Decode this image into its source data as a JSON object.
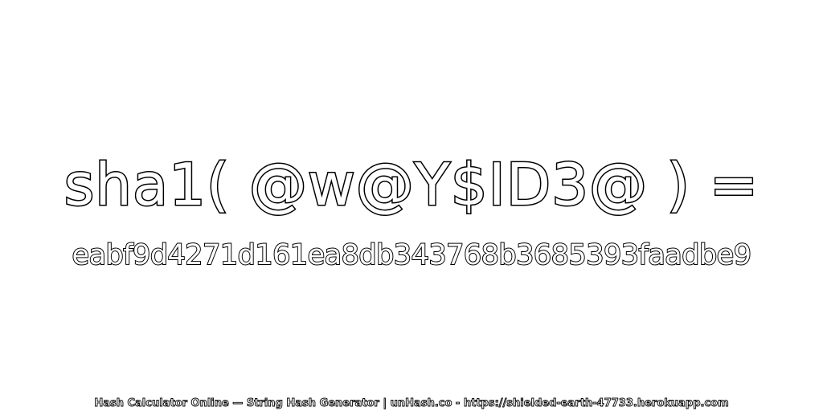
{
  "expression": "sha1( @w@Y$ID3@ ) =",
  "hash": "eabf9d4271d161ea8db343768b3685393faadbe9",
  "footer": "Hash Calculator Online — String Hash Generator | unHash.co - https://shielded-earth-47733.herokuapp.com",
  "colors": {
    "background": "#ffffff",
    "text_fill": "#ffffff",
    "text_outline": "#000000"
  }
}
